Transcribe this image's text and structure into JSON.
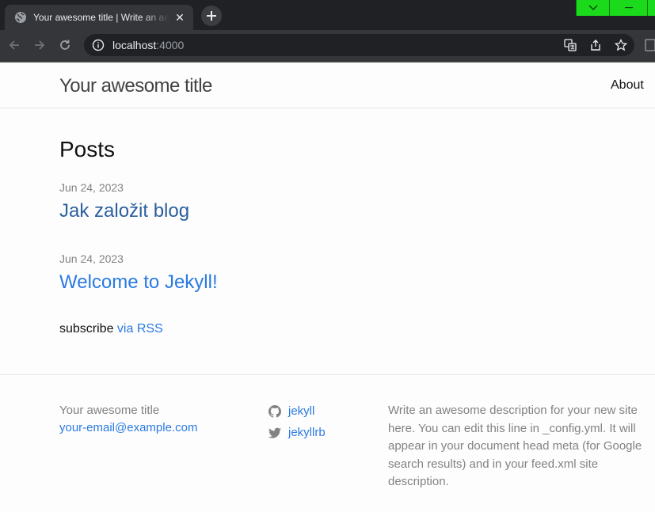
{
  "browser": {
    "tab_title": "Your awesome title | Write an awesome description for your new site",
    "tab_close": "✕",
    "new_tab": "+",
    "url_host": "localhost",
    "url_port": ":4000"
  },
  "header": {
    "site_title": "Your awesome title",
    "nav": [
      {
        "label": "About"
      }
    ]
  },
  "main": {
    "heading": "Posts",
    "posts": [
      {
        "date": "Jun 24, 2023",
        "title": "Jak založit blog"
      },
      {
        "date": "Jun 24, 2023",
        "title": "Welcome to Jekyll!"
      }
    ],
    "subscribe_text": "subscribe ",
    "subscribe_link": "via RSS"
  },
  "footer": {
    "site_name": "Your awesome title",
    "email": "your-email@example.com",
    "social": [
      {
        "icon": "github-icon",
        "label": "jekyll"
      },
      {
        "icon": "twitter-icon",
        "label": "jekyllrb"
      }
    ],
    "description": "Write an awesome description for your new site here. You can edit this line in _config.yml. It will appear in your document head meta (for Google search results) and in your feed.xml site description."
  },
  "colors": {
    "link": "#2a7ae2",
    "visited_link": "#2c5f9e",
    "muted": "#828282",
    "window_controls": "#1bd91b"
  }
}
